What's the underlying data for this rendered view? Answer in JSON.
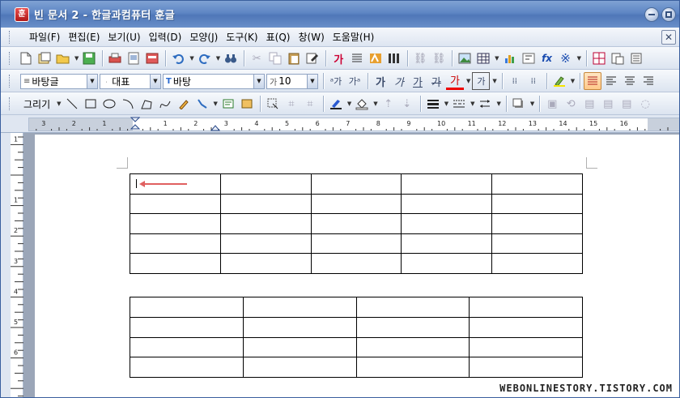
{
  "window": {
    "title": "빈 문서 2 - 한글과컴퓨터 훈글",
    "app_icon_label": "훈"
  },
  "menu": {
    "items": [
      "파일(F)",
      "편집(E)",
      "보기(U)",
      "입력(D)",
      "모양(J)",
      "도구(K)",
      "표(Q)",
      "창(W)",
      "도움말(H)"
    ]
  },
  "format_toolbar": {
    "style": "바탕글",
    "language": "대표",
    "font": "바탕",
    "size": "10",
    "bold_label": "가",
    "italic_label": "가",
    "underline_label": "가",
    "strike_label": "가",
    "color_label": "가",
    "box_label": "가"
  },
  "draw_toolbar": {
    "label": "그리기"
  },
  "ruler": {
    "ticks": [
      "3",
      "2",
      "1",
      "1",
      "2",
      "3",
      "4",
      "5",
      "6",
      "7",
      "8",
      "9",
      "10",
      "11",
      "12",
      "13",
      "14",
      "15",
      "16"
    ]
  },
  "vruler": {
    "ticks": [
      "1",
      "1",
      "2",
      "3",
      "4",
      "5",
      "6"
    ]
  },
  "tables": [
    {
      "rows": 5,
      "cols": 5
    },
    {
      "rows": 4,
      "cols": 4
    }
  ],
  "accent_color": "#e06060",
  "watermark": "WEBONLINESTORY.TISTORY.COM"
}
